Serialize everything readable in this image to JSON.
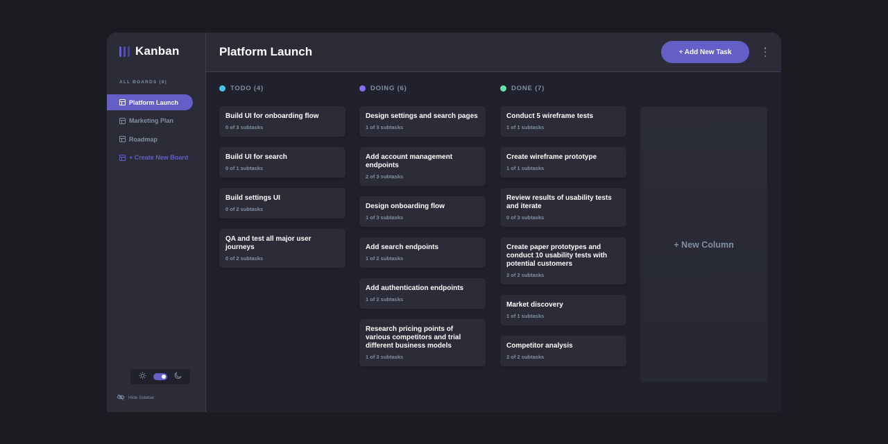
{
  "app": {
    "title": "Kanban"
  },
  "sidebar": {
    "heading": "ALL BOARDS (8)",
    "boards": [
      {
        "label": "Platform Launch",
        "active": true
      },
      {
        "label": "Marketing Plan",
        "active": false
      },
      {
        "label": "Roadmap",
        "active": false
      }
    ],
    "create_label": "+ Create New Board",
    "theme": {
      "mode": "dark",
      "light_icon": "sun-icon",
      "dark_icon": "moon-icon"
    },
    "hide_label": "Hide Sidebar"
  },
  "header": {
    "title": "Platform Launch",
    "add_task_label": "+ Add New Task",
    "menu_icon": "vertical-ellipsis-icon"
  },
  "columns": [
    {
      "title": "TODO (4)",
      "color": "#49c4e5",
      "tasks": [
        {
          "title": "Build UI for onboarding flow",
          "subtasks": "0 of 3 subtasks"
        },
        {
          "title": "Build UI for search",
          "subtasks": "0 of 1 subtasks"
        },
        {
          "title": "Build settings UI",
          "subtasks": "0 of 2 subtasks"
        },
        {
          "title": "QA and test all major user journeys",
          "subtasks": "0 of 2 subtasks"
        }
      ]
    },
    {
      "title": "DOING (6)",
      "color": "#8471f2",
      "tasks": [
        {
          "title": "Design settings and search pages",
          "subtasks": "1 of 3 subtasks"
        },
        {
          "title": "Add account management endpoints",
          "subtasks": "2 of 3 subtasks"
        },
        {
          "title": "Design onboarding flow",
          "subtasks": "1 of 3 subtasks"
        },
        {
          "title": "Add search endpoints",
          "subtasks": "1 of 2 subtasks"
        },
        {
          "title": "Add authentication endpoints",
          "subtasks": "1 of 2 subtasks"
        },
        {
          "title": "Research pricing points of various competitors and trial different business models",
          "subtasks": "1 of 3 subtasks"
        }
      ]
    },
    {
      "title": "DONE (7)",
      "color": "#67e2ae",
      "tasks": [
        {
          "title": "Conduct 5 wireframe tests",
          "subtasks": "1 of 1 subtasks"
        },
        {
          "title": "Create wireframe prototype",
          "subtasks": "1 of 1 subtasks"
        },
        {
          "title": "Review results of usability tests and iterate",
          "subtasks": "0 of 3 subtasks"
        },
        {
          "title": "Create paper prototypes and conduct 10 usability tests with potential customers",
          "subtasks": "2 of 2 subtasks"
        },
        {
          "title": "Market discovery",
          "subtasks": "1 of 1 subtasks"
        },
        {
          "title": "Competitor analysis",
          "subtasks": "2 of 2 subtasks"
        }
      ]
    }
  ],
  "new_column_label": "+ New Column",
  "colors": {
    "accent": "#635fc7",
    "background": "#20212c",
    "surface": "#2b2c37",
    "muted_text": "#828fa3"
  }
}
